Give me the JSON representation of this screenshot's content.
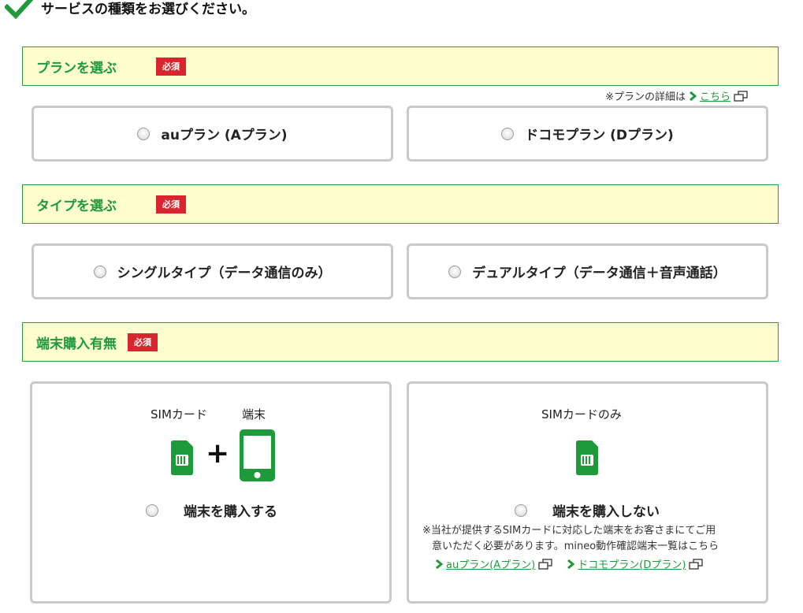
{
  "heading": {
    "title": "サービスの種類をお選びください。"
  },
  "sections": {
    "plan": {
      "title": "プランを選ぶ",
      "badge": "必須"
    },
    "type": {
      "title": "タイプを選ぶ",
      "badge": "必須"
    },
    "device": {
      "title": "端末購入有無",
      "badge": "必須"
    }
  },
  "plan_note": {
    "prefix": "※プランの詳細は",
    "link": "こちら"
  },
  "plans": [
    {
      "label": "auプラン (Aプラン)"
    },
    {
      "label": "ドコモプラン (Dプラン)"
    }
  ],
  "types": [
    {
      "label": "シングルタイプ（データ通信のみ）"
    },
    {
      "label": "デュアルタイプ（データ通信＋音声通話）"
    }
  ],
  "device_options": {
    "buy": {
      "sim_label": "SIMカード",
      "device_label": "端末",
      "plus": "+",
      "label": "端末を購入する"
    },
    "no_buy": {
      "sim_label": "SIMカードのみ",
      "label": "端末を購入しない",
      "note_line1": "※当社が提供するSIMカードに対応した端末をお客さまにてご用",
      "note_line2": "意いただく必要があります。mineo動作確認端末一覧はこちら",
      "link_a": "auプラン(Aプラン)",
      "link_d": "ドコモプラン(Dプラン)"
    }
  },
  "colors": {
    "accent_green": "#1e9a3a",
    "badge_red": "#d8262e",
    "section_bg": "#fefece"
  }
}
